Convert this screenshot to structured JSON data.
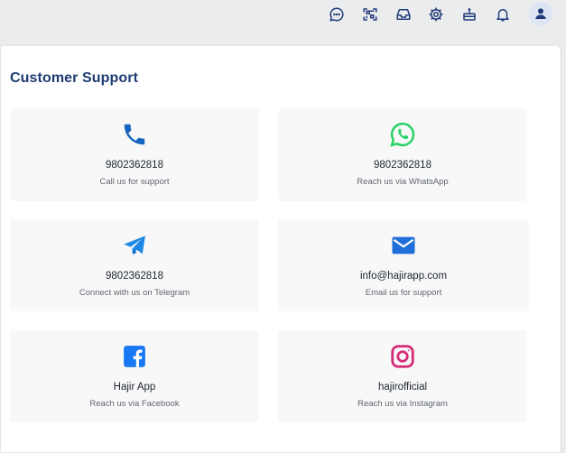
{
  "topbar": {
    "icons": [
      "chat-icon",
      "qr-scan-icon",
      "inbox-icon",
      "gear-icon",
      "cake-icon",
      "bell-icon",
      "user-icon"
    ]
  },
  "page": {
    "title": "Customer Support"
  },
  "contacts": [
    {
      "icon": "phone-icon",
      "value": "9802362818",
      "caption": "Call us for support",
      "color": "#1565c0"
    },
    {
      "icon": "whatsapp-icon",
      "value": "9802362818",
      "caption": "Reach us via WhatsApp",
      "color": "#25d366"
    },
    {
      "icon": "telegram-icon",
      "value": "9802362818",
      "caption": "Connect with us on Telegram",
      "color": "#1e88e5"
    },
    {
      "icon": "mail-icon",
      "value": "info@hajirapp.com",
      "caption": "Email us for support",
      "color": "#1e6fd9"
    },
    {
      "icon": "facebook-icon",
      "value": "Hajir App",
      "caption": "Reach us via Facebook",
      "color": "#1877f2"
    },
    {
      "icon": "instagram-icon",
      "value": "hajirofficial",
      "caption": "Reach us via Instagram",
      "color": "#d62976"
    }
  ]
}
